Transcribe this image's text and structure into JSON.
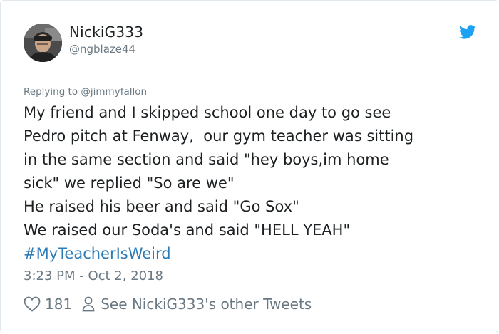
{
  "author": {
    "display_name": "NickiG333",
    "handle": "@ngblaze44"
  },
  "reply_context": "Replying to @jimmyfallon",
  "tweet": {
    "lines": [
      "My friend and I skipped school one day to go see",
      "Pedro pitch at Fenway,  our gym teacher was sitting",
      "in the same section and said \"hey boys,im home",
      "sick\" we replied \"So are we\"",
      "He raised his beer and said \"Go Sox\"",
      "We raised our Soda's and said \"HELL YEAH\""
    ],
    "hashtag": "#MyTeacherIsWeird"
  },
  "timestamp": "3:23 PM - Oct 2, 2018",
  "actions": {
    "like_count": "181",
    "profile_link": "See NickiG333's other Tweets"
  },
  "colors": {
    "link": "#2b7bb9",
    "twitter_blue": "#1da1f2",
    "muted_text": "#697882",
    "primary_text": "#1c2022"
  },
  "icons": {
    "avatar": "avatar",
    "brand": "twitter-bird-icon",
    "like": "heart-icon",
    "profile": "person-icon"
  }
}
